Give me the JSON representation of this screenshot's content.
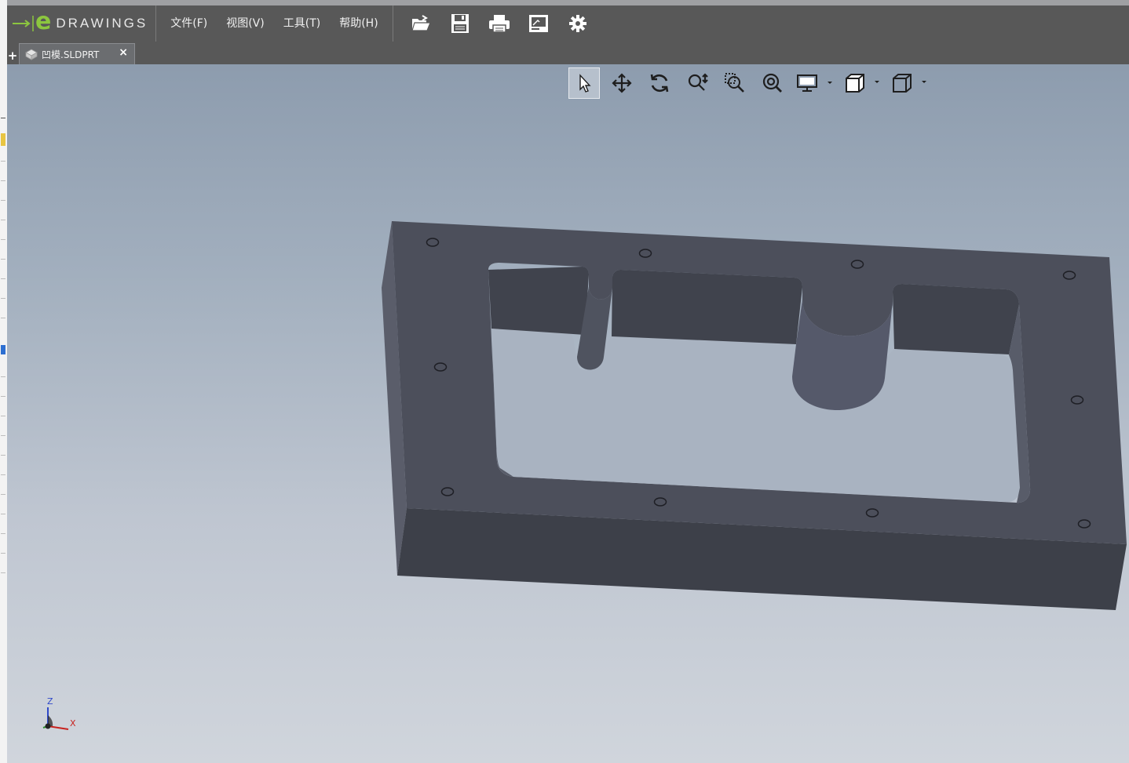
{
  "app": {
    "logo_text": "DRAWINGS",
    "logo_prefix": "e",
    "brand_color": "#8cc63f"
  },
  "menu": {
    "items": [
      "文件(F)",
      "视图(V)",
      "工具(T)",
      "帮助(H)"
    ]
  },
  "toolbar": {
    "icons": [
      "open-folder-icon",
      "save-icon",
      "print-icon",
      "markup-icon",
      "settings-gear-icon"
    ]
  },
  "tabs": [
    {
      "label": "凹模.SLDPRT",
      "icon": "part-icon",
      "active": true
    }
  ],
  "view_toolbar": {
    "icons": [
      "select-arrow-icon",
      "pan-icon",
      "rotate-icon",
      "zoom-to-fit-icon",
      "zoom-to-area-icon",
      "zoom-in-out-icon",
      "display-style-icon",
      "view-orientation-icon",
      "standard-views-icon"
    ],
    "active": "select-arrow-icon"
  },
  "triad": {
    "z_label": "Z",
    "x_label": "X"
  }
}
